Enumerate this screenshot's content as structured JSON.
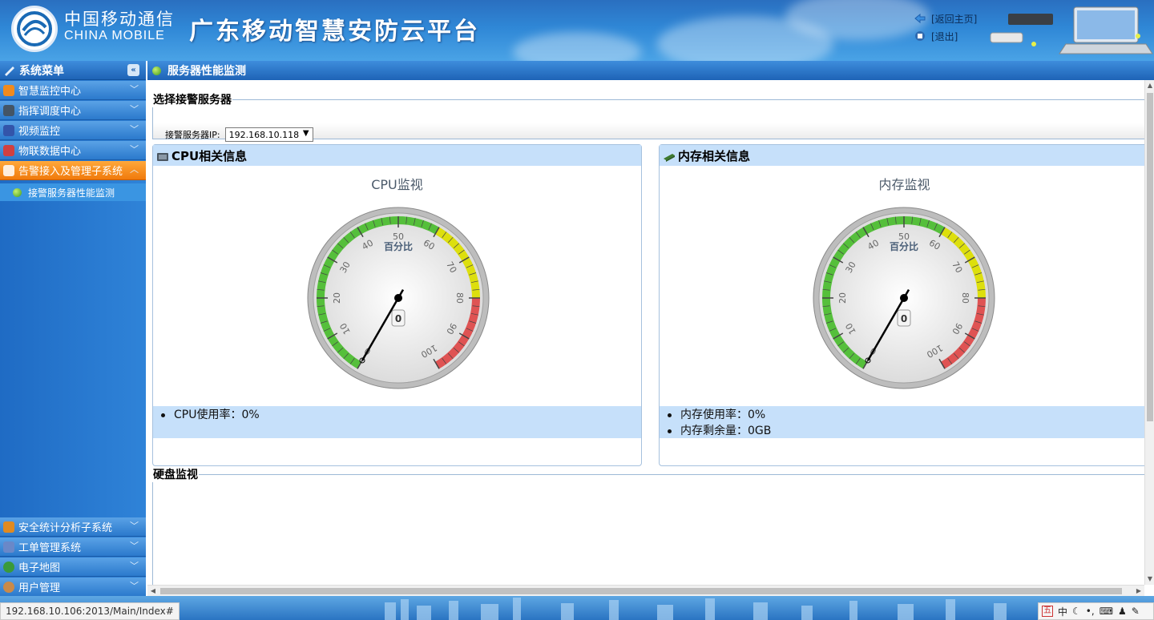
{
  "header": {
    "brand_cn": "中国移动通信",
    "brand_en": "CHINA MOBILE",
    "platform_title": "广东移动智慧安防云平台",
    "links": [
      {
        "label": "[返回主页]",
        "icon": "home-arrow-icon"
      },
      {
        "label": "[退出]",
        "icon": "logout-icon"
      }
    ]
  },
  "sidebar": {
    "title": "系统菜单",
    "collapse_icon": "double-chevron-left-icon",
    "items": [
      {
        "label": "智慧监控中心",
        "icon": "monitor-center-icon",
        "color": "#f08a1e"
      },
      {
        "label": "指挥调度中心",
        "icon": "dispatch-icon",
        "color": "#445566"
      },
      {
        "label": "视频监控",
        "icon": "camera-icon",
        "color": "#3355aa"
      },
      {
        "label": "物联数据中心",
        "icon": "iot-data-icon",
        "color": "#d04040"
      },
      {
        "label": "告警接入及管理子系统",
        "icon": "alarm-icon",
        "color": "#ffffff",
        "active": true
      },
      {
        "label": "安全统计分析子系统",
        "icon": "statistics-icon",
        "color": "#e08a20"
      },
      {
        "label": "工单管理系统",
        "icon": "work-order-icon",
        "color": "#6a88c8"
      },
      {
        "label": "电子地图",
        "icon": "globe-icon",
        "color": "#3a9a3a"
      },
      {
        "label": "用户管理",
        "icon": "user-icon",
        "color": "#c98a4a"
      }
    ],
    "sub_item": "接警服务器性能监测"
  },
  "main": {
    "title": "服务器性能监测",
    "server_select": {
      "legend": "选择接警服务器",
      "label": "接警服务器IP:",
      "value": "192.168.10.118"
    },
    "cpu": {
      "header": "CPU相关信息",
      "gauge_title": "CPU监视",
      "gauge_unit": "百分比",
      "value": 0,
      "stats": [
        "CPU使用率：0%"
      ]
    },
    "memory": {
      "header": "内存相关信息",
      "gauge_title": "内存监视",
      "gauge_unit": "百分比",
      "value": 0,
      "stats": [
        "内存使用率：0%",
        "内存剩余量：0GB"
      ]
    },
    "disk": {
      "legend": "硬盘监视"
    },
    "gauge_ticks": [
      "0",
      "10",
      "20",
      "30",
      "40",
      "50",
      "60",
      "70",
      "80",
      "90",
      "100"
    ],
    "gauge_colors": {
      "green": "#55bf3b",
      "yellow": "#dddf0d",
      "red": "#df5353"
    }
  },
  "statusbar": {
    "url": "192.168.10.106:2013/Main/Index#",
    "ime": [
      "五",
      "中"
    ]
  }
}
